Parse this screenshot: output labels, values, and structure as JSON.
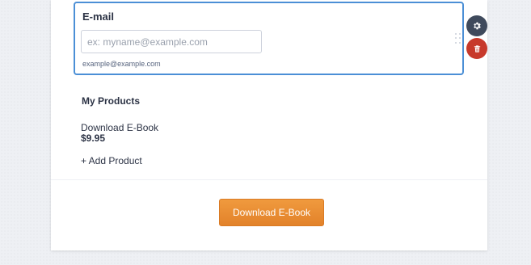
{
  "email": {
    "label": "E-mail",
    "placeholder": "ex: myname@example.com",
    "value": "",
    "sublabel": "example@example.com"
  },
  "toolbar": {
    "settings_icon": "gear-icon",
    "delete_icon": "trash-icon",
    "settings_color": "#3f4a5c",
    "delete_color": "#c7392b"
  },
  "products": {
    "title": "My Products",
    "items": [
      {
        "name": "Download E-Book",
        "price": "$9.95"
      }
    ],
    "add_label": "+ Add Product"
  },
  "submit": {
    "label": "Download E-Book",
    "color": "#e8892f"
  },
  "colors": {
    "selection_border": "#4b8fd6"
  }
}
